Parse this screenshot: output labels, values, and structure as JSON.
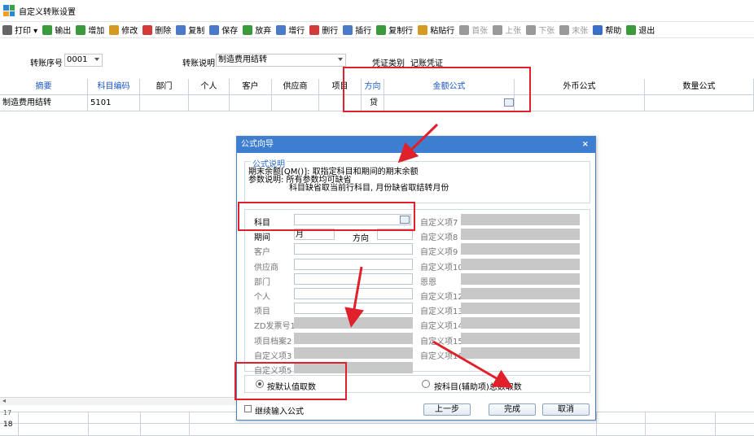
{
  "window": {
    "title": "自定义转账设置"
  },
  "toolbar": [
    {
      "icon": "printer-icon",
      "label": "打印 ▾",
      "enabled": true,
      "color": "#666666"
    },
    {
      "icon": "export-icon",
      "label": "输出",
      "enabled": true,
      "color": "#3b9a3b"
    },
    {
      "icon": "add-icon",
      "label": "增加",
      "enabled": true,
      "color": "#3b9a3b"
    },
    {
      "icon": "pencil-icon",
      "label": "修改",
      "enabled": true,
      "color": "#d49a22"
    },
    {
      "icon": "delete-icon",
      "label": "删除",
      "enabled": true,
      "color": "#d33a3a"
    },
    {
      "icon": "copy-icon",
      "label": "复制",
      "enabled": true,
      "color": "#4a7ac8"
    },
    {
      "icon": "save-icon",
      "label": "保存",
      "enabled": true,
      "color": "#4a7ac8"
    },
    {
      "icon": "discard-icon",
      "label": "放弃",
      "enabled": true,
      "color": "#3b9a3b"
    },
    {
      "icon": "add-row-icon",
      "label": "增行",
      "enabled": true,
      "color": "#4a7ac8"
    },
    {
      "icon": "delete-row-icon",
      "label": "删行",
      "enabled": true,
      "color": "#d33a3a"
    },
    {
      "icon": "insert-row-icon",
      "label": "插行",
      "enabled": true,
      "color": "#4a7ac8"
    },
    {
      "icon": "copy-row-icon",
      "label": "复制行",
      "enabled": true,
      "color": "#3b9a3b"
    },
    {
      "icon": "paste-row-icon",
      "label": "粘贴行",
      "enabled": true,
      "color": "#d49a22"
    },
    {
      "icon": "first-page-icon",
      "label": "首张",
      "enabled": false,
      "color": "#9a9a9a"
    },
    {
      "icon": "prev-page-icon",
      "label": "上张",
      "enabled": false,
      "color": "#9a9a9a"
    },
    {
      "icon": "next-page-icon",
      "label": "下张",
      "enabled": false,
      "color": "#9a9a9a"
    },
    {
      "icon": "last-page-icon",
      "label": "末张",
      "enabled": false,
      "color": "#9a9a9a"
    },
    {
      "icon": "help-icon",
      "label": "帮助",
      "enabled": true,
      "color": "#3a6fc8"
    },
    {
      "icon": "exit-icon",
      "label": "退出",
      "enabled": true,
      "color": "#3b9a3b"
    }
  ],
  "form": {
    "seq_label": "转账序号",
    "seq_value": "0001",
    "desc_label": "转账说明",
    "desc_value": "制造费用结转",
    "voucher_label": "凭证类别",
    "voucher_value": "记账凭证"
  },
  "grid": {
    "headers": [
      "摘要",
      "科目编码",
      "部门",
      "个人",
      "客户",
      "供应商",
      "项目",
      "方向",
      "金额公式",
      "外币公式",
      "数量公式"
    ],
    "row": [
      "制造费用结转",
      "5101",
      "",
      "",
      "",
      "",
      "",
      "贷",
      "",
      "",
      ""
    ],
    "row_numbers": [
      "17",
      "18"
    ]
  },
  "dialog": {
    "title": "公式向导",
    "close": "×",
    "desc_legend": "公式说明",
    "desc_lines": [
      "期末余额[QM()]: 取指定科目和期间的期末余额",
      "参数说明: 所有参数均可缺省",
      "科目缺省取当前行科目, 月份缺省取结转月份"
    ],
    "left_fields": [
      "科目",
      "期间",
      "客户",
      "供应商",
      "部门",
      "个人",
      "项目",
      "ZD发票号1",
      "项目档案2",
      "自定义项3",
      "自定义项5"
    ],
    "period_value": "月",
    "direction_label": "方向",
    "right_fields": [
      "自定义项7",
      "自定义项8",
      "自定义项9",
      "自定义项10",
      "恩恩",
      "自定义项12",
      "自定义项13",
      "自定义项14",
      "自定义项15",
      "自定义项16"
    ],
    "radio_default": "按默认值取数",
    "radio_aux": "按科目(辅助项)总数取数",
    "continue_label": "继续输入公式",
    "prev_button": "上一步",
    "finish_button": "完成",
    "cancel_button": "取消"
  },
  "colors": {
    "header_blue": "#1a56c4",
    "dialog_title": "#3d7ed0",
    "annotation_red": "#e0202a"
  }
}
